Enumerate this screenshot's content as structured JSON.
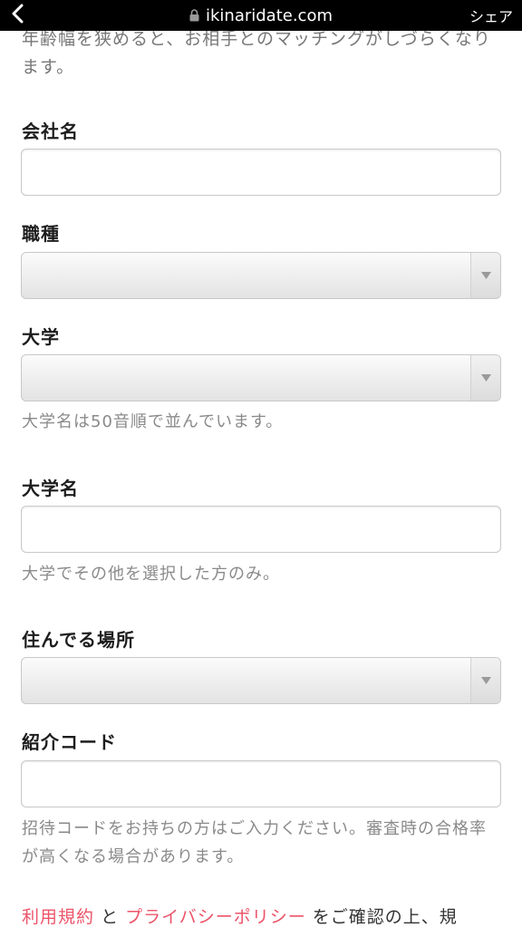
{
  "browser": {
    "url": "ikinaridate.com",
    "share_label": "シェア",
    "icons": {
      "back": "chevron-left-icon",
      "lock": "lock-icon"
    }
  },
  "intro_text": "年齢幅を狭めると、お相手とのマッチングがしづらくなります。",
  "form": {
    "company": {
      "label": "会社名",
      "value": ""
    },
    "job": {
      "label": "職種",
      "selected": ""
    },
    "university": {
      "label": "大学",
      "selected": "",
      "help": "大学名は50音順で並んでいます。"
    },
    "university_name": {
      "label": "大学名",
      "value": "",
      "help": "大学でその他を選択した方のみ。"
    },
    "residence": {
      "label": "住んでる場所",
      "selected": ""
    },
    "referral": {
      "label": "紹介コード",
      "value": "",
      "help": "招待コードをお持ちの方はご入力ください。審査時の合格率が高くなる場合があります。"
    }
  },
  "terms": {
    "terms_link": "利用規約",
    "and": "と",
    "privacy_link": "プライバシーポリシー",
    "suffix": "をご確認の上、規"
  },
  "colors": {
    "link": "#ec5469",
    "topbar": "#000000",
    "help_text": "#8a8a8a"
  }
}
